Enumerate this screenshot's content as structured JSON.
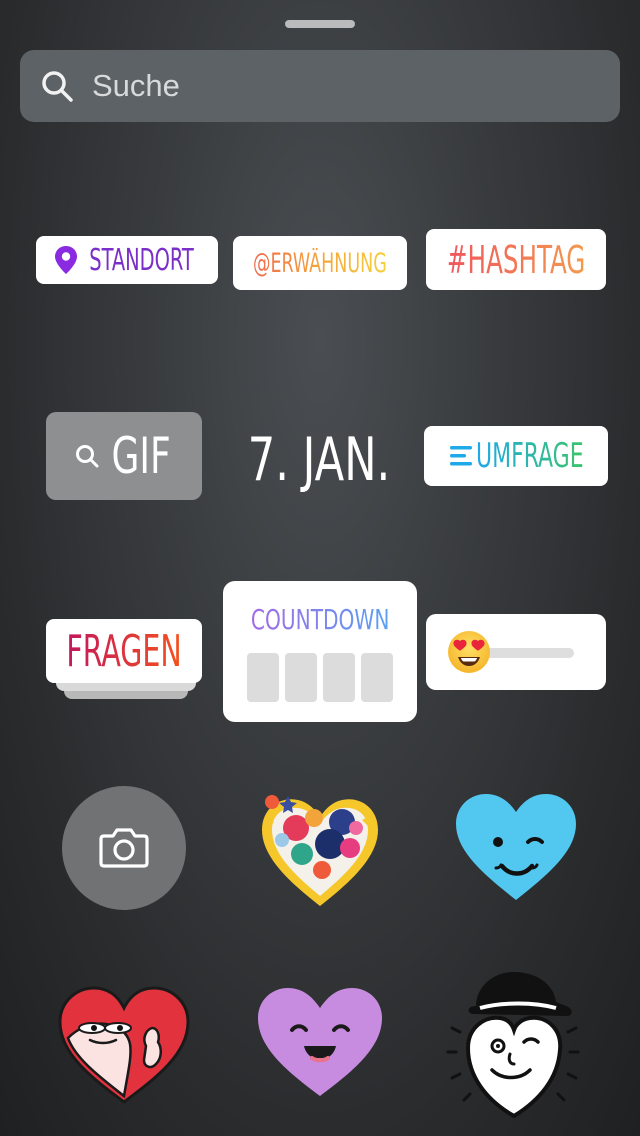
{
  "search": {
    "placeholder": "Suche"
  },
  "stickers": {
    "location": "STANDORT",
    "mention": "@ERWÄHNUNG",
    "hashtag": "#HASHTAG",
    "gif": "GIF",
    "date": "7. JAN.",
    "poll": "UMFRAGE",
    "questions": "FRAGEN",
    "countdown": "COUNTDOWN"
  },
  "colors": {
    "location": "#8a2be2",
    "hashtag_start": "#f0565d",
    "hashtag_end": "#f39a4e",
    "poll_start": "#1ea9e8",
    "poll_end": "#3cc46b",
    "questions_start": "#c2185b",
    "questions_end": "#f4511e",
    "countdown_start": "#a26be6",
    "countdown_end": "#5aa0f2"
  },
  "icons": [
    "handle-bar",
    "search-icon",
    "pin-icon",
    "camera-icon",
    "heart-in-hands-sticker",
    "blue-winking-heart-sticker",
    "red-heart-character-sticker",
    "purple-smiling-heart-sticker",
    "cartoon-face-hat-sticker"
  ]
}
